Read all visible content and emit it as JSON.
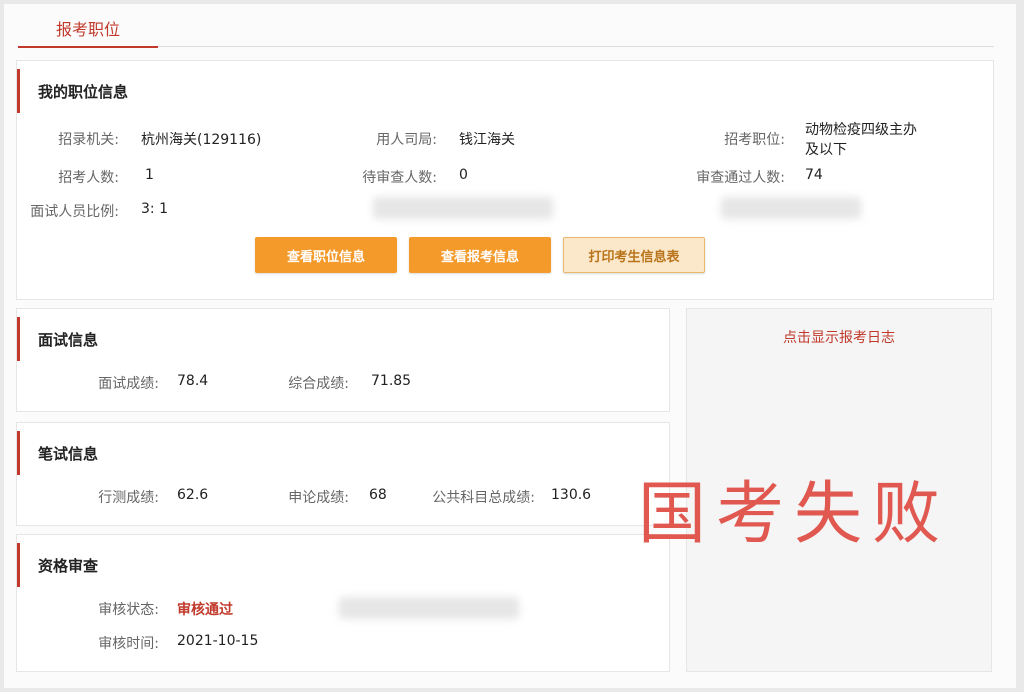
{
  "tab": {
    "label": "报考职位"
  },
  "position_info": {
    "title": "我的职位信息",
    "fields": {
      "recruit_org_label": "招录机关:",
      "recruit_org_value": "杭州海关(129116)",
      "employer_label": "用人司局:",
      "employer_value": "钱江海关",
      "position_label": "招考职位:",
      "position_value_line1": "动物检疫四级主办",
      "position_value_line2": "及以下",
      "recruit_count_label": "招考人数:",
      "recruit_count_value": "1",
      "pending_count_label": "待审查人数:",
      "pending_count_value": "0",
      "passed_count_label": "审查通过人数:",
      "passed_count_value": "74",
      "interview_ratio_label": "面试人员比例:",
      "interview_ratio_value": "3: 1"
    },
    "buttons": {
      "view_position": "查看职位信息",
      "view_application": "查看报考信息",
      "print_form": "打印考生信息表"
    }
  },
  "interview": {
    "title": "面试信息",
    "score_label": "面试成绩:",
    "score_value": "78.4",
    "total_label": "综合成绩:",
    "total_value": "71.85"
  },
  "written": {
    "title": "笔试信息",
    "xingce_label": "行测成绩:",
    "xingce_value": "62.6",
    "shenlun_label": "申论成绩:",
    "shenlun_value": "68",
    "public_total_label": "公共科目总成绩:",
    "public_total_value": "130.6"
  },
  "qualification": {
    "title": "资格审查",
    "status_label": "审核状态:",
    "status_value": "审核通过",
    "time_label": "审核时间:",
    "time_value": "2021-10-15"
  },
  "log": {
    "link_text": "点击显示报考日志"
  },
  "overlay": {
    "text": "国考失败",
    "color": "#e0584f"
  },
  "colors": {
    "accent": "#c0392b",
    "button": "#f39a2b"
  }
}
